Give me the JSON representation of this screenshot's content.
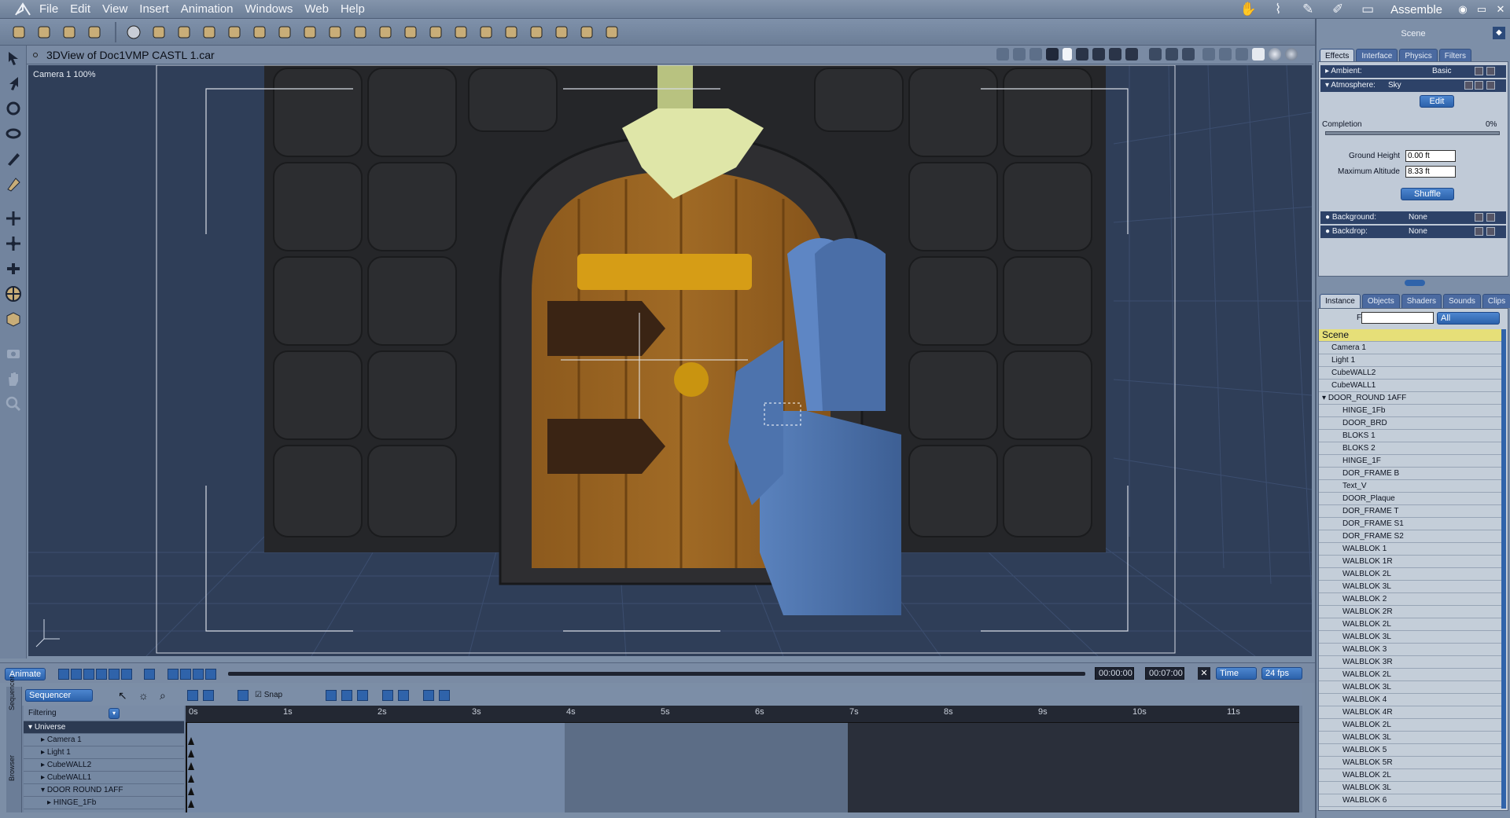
{
  "app": {
    "menus": [
      "File",
      "Edit",
      "View",
      "Insert",
      "Animation",
      "Windows",
      "Web",
      "Help"
    ],
    "room": "Assemble",
    "room_icons": [
      "hand-icon",
      "pose-brush-icon",
      "paint-brush-icon",
      "brush-icon",
      "document-icon"
    ]
  },
  "toolbar": {
    "tools": [
      "paint-icon",
      "hand-tool-icon",
      "grab-icon",
      "brush-icon",
      "sphere-icon",
      "cylinder-icon",
      "torus-icon",
      "figure-icon",
      "ring-icon",
      "text-icon",
      "gear-icon",
      "plane-icon",
      "tree-icon",
      "hat-icon",
      "drop-icon",
      "box-icon",
      "box2-icon",
      "text-agi-icon",
      "bowl-icon",
      "pen-icon",
      "spider-icon",
      "network-icon",
      "circle-icon",
      "wand-icon"
    ]
  },
  "viewport": {
    "title": "3DView of Doc1VMP  CASTL 1.car",
    "camera_label": "Camera 1 100%"
  },
  "animation": {
    "animate_label": "Animate",
    "current_time": "00:00:00",
    "end_time": "00:07:00",
    "time_mode": "Time",
    "fps": "24 fps"
  },
  "sequencer": {
    "mode": "Sequencer",
    "filtering_label": "Filtering",
    "snap_label": "Snap",
    "side_tabs": [
      "Sequencer",
      "Browser"
    ],
    "tracks": [
      "Universe",
      "Camera 1",
      "Light 1",
      "CubeWALL2",
      "CubeWALL1",
      "DOOR  ROUND 1AFF",
      "HINGE_1Fb"
    ],
    "ruler": [
      "0s",
      "1s",
      "2s",
      "3s",
      "4s",
      "5s",
      "6s",
      "7s",
      "8s",
      "9s",
      "10s",
      "11s"
    ]
  },
  "right_panel": {
    "header": "Scene",
    "effect_tabs": [
      "Effects",
      "Interface",
      "Physics",
      "Filters"
    ],
    "ambient_label": "Ambient:",
    "ambient_value": "Basic",
    "atmosphere_label": "Atmosphere:",
    "atmosphere_value": "Sky",
    "edit_label": "Edit",
    "completion_label": "Completion",
    "completion_value": "0%",
    "completion_fraction": 0,
    "ground_height_label": "Ground Height",
    "ground_height_value": "0.00 ft",
    "max_altitude_label": "Maximum Altitude",
    "max_altitude_value": "8.33 ft",
    "shuffle_label": "Shuffle",
    "background_label": "Background:",
    "background_value": "None",
    "backdrop_label": "Backdrop:",
    "backdrop_value": "None",
    "instance_tabs": [
      "Instance",
      "Objects",
      "Shaders",
      "Sounds",
      "Clips"
    ],
    "find_label": "Find:",
    "find_value": "",
    "filter_value": "All",
    "scene_root": "Scene",
    "top_items": [
      "Camera 1",
      "Light 1",
      "CubeWALL2",
      "CubeWALL1"
    ],
    "group": "DOOR_ROUND 1AFF",
    "children": [
      "HINGE_1Fb",
      "DOOR_BRD",
      "BLOKS 1",
      "BLOKS 2",
      "HINGE_1F",
      "DOR_FRAME  B",
      "Text_V",
      "DOOR_Plaque",
      "DOR_FRAME  T",
      "DOR_FRAME S1",
      "DOR_FRAME S2",
      "WALBLOK 1",
      "WALBLOK 1R",
      "WALBLOK 2L",
      "WALBLOK 3L",
      "WALBLOK 2",
      "WALBLOK 2R",
      "WALBLOK 2L",
      "WALBLOK 3L",
      "WALBLOK 3",
      "WALBLOK 3R",
      "WALBLOK 2L",
      "WALBLOK 3L",
      "WALBLOK 4",
      "WALBLOK 4R",
      "WALBLOK 2L",
      "WALBLOK 3L",
      "WALBLOK 5",
      "WALBLOK 5R",
      "WALBLOK 2L",
      "WALBLOK 3L",
      "WALBLOK 6"
    ]
  }
}
